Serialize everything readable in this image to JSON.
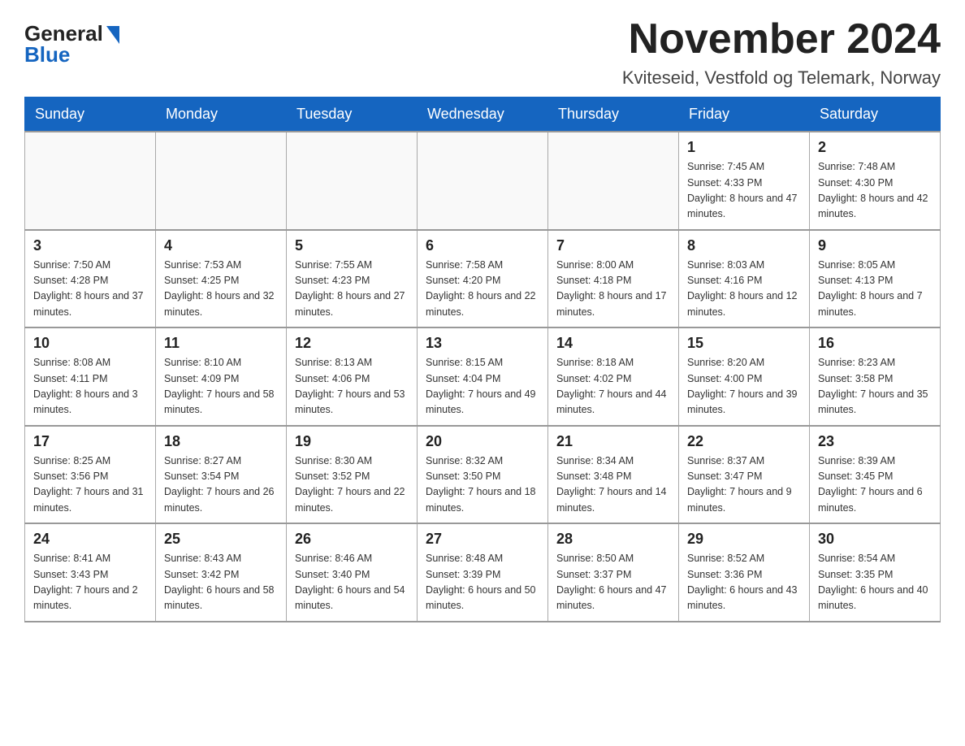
{
  "logo": {
    "general": "General",
    "blue": "Blue"
  },
  "title": "November 2024",
  "location": "Kviteseid, Vestfold og Telemark, Norway",
  "headers": [
    "Sunday",
    "Monday",
    "Tuesday",
    "Wednesday",
    "Thursday",
    "Friday",
    "Saturday"
  ],
  "weeks": [
    [
      {
        "day": "",
        "info": ""
      },
      {
        "day": "",
        "info": ""
      },
      {
        "day": "",
        "info": ""
      },
      {
        "day": "",
        "info": ""
      },
      {
        "day": "",
        "info": ""
      },
      {
        "day": "1",
        "info": "Sunrise: 7:45 AM\nSunset: 4:33 PM\nDaylight: 8 hours and 47 minutes."
      },
      {
        "day": "2",
        "info": "Sunrise: 7:48 AM\nSunset: 4:30 PM\nDaylight: 8 hours and 42 minutes."
      }
    ],
    [
      {
        "day": "3",
        "info": "Sunrise: 7:50 AM\nSunset: 4:28 PM\nDaylight: 8 hours and 37 minutes."
      },
      {
        "day": "4",
        "info": "Sunrise: 7:53 AM\nSunset: 4:25 PM\nDaylight: 8 hours and 32 minutes."
      },
      {
        "day": "5",
        "info": "Sunrise: 7:55 AM\nSunset: 4:23 PM\nDaylight: 8 hours and 27 minutes."
      },
      {
        "day": "6",
        "info": "Sunrise: 7:58 AM\nSunset: 4:20 PM\nDaylight: 8 hours and 22 minutes."
      },
      {
        "day": "7",
        "info": "Sunrise: 8:00 AM\nSunset: 4:18 PM\nDaylight: 8 hours and 17 minutes."
      },
      {
        "day": "8",
        "info": "Sunrise: 8:03 AM\nSunset: 4:16 PM\nDaylight: 8 hours and 12 minutes."
      },
      {
        "day": "9",
        "info": "Sunrise: 8:05 AM\nSunset: 4:13 PM\nDaylight: 8 hours and 7 minutes."
      }
    ],
    [
      {
        "day": "10",
        "info": "Sunrise: 8:08 AM\nSunset: 4:11 PM\nDaylight: 8 hours and 3 minutes."
      },
      {
        "day": "11",
        "info": "Sunrise: 8:10 AM\nSunset: 4:09 PM\nDaylight: 7 hours and 58 minutes."
      },
      {
        "day": "12",
        "info": "Sunrise: 8:13 AM\nSunset: 4:06 PM\nDaylight: 7 hours and 53 minutes."
      },
      {
        "day": "13",
        "info": "Sunrise: 8:15 AM\nSunset: 4:04 PM\nDaylight: 7 hours and 49 minutes."
      },
      {
        "day": "14",
        "info": "Sunrise: 8:18 AM\nSunset: 4:02 PM\nDaylight: 7 hours and 44 minutes."
      },
      {
        "day": "15",
        "info": "Sunrise: 8:20 AM\nSunset: 4:00 PM\nDaylight: 7 hours and 39 minutes."
      },
      {
        "day": "16",
        "info": "Sunrise: 8:23 AM\nSunset: 3:58 PM\nDaylight: 7 hours and 35 minutes."
      }
    ],
    [
      {
        "day": "17",
        "info": "Sunrise: 8:25 AM\nSunset: 3:56 PM\nDaylight: 7 hours and 31 minutes."
      },
      {
        "day": "18",
        "info": "Sunrise: 8:27 AM\nSunset: 3:54 PM\nDaylight: 7 hours and 26 minutes."
      },
      {
        "day": "19",
        "info": "Sunrise: 8:30 AM\nSunset: 3:52 PM\nDaylight: 7 hours and 22 minutes."
      },
      {
        "day": "20",
        "info": "Sunrise: 8:32 AM\nSunset: 3:50 PM\nDaylight: 7 hours and 18 minutes."
      },
      {
        "day": "21",
        "info": "Sunrise: 8:34 AM\nSunset: 3:48 PM\nDaylight: 7 hours and 14 minutes."
      },
      {
        "day": "22",
        "info": "Sunrise: 8:37 AM\nSunset: 3:47 PM\nDaylight: 7 hours and 9 minutes."
      },
      {
        "day": "23",
        "info": "Sunrise: 8:39 AM\nSunset: 3:45 PM\nDaylight: 7 hours and 6 minutes."
      }
    ],
    [
      {
        "day": "24",
        "info": "Sunrise: 8:41 AM\nSunset: 3:43 PM\nDaylight: 7 hours and 2 minutes."
      },
      {
        "day": "25",
        "info": "Sunrise: 8:43 AM\nSunset: 3:42 PM\nDaylight: 6 hours and 58 minutes."
      },
      {
        "day": "26",
        "info": "Sunrise: 8:46 AM\nSunset: 3:40 PM\nDaylight: 6 hours and 54 minutes."
      },
      {
        "day": "27",
        "info": "Sunrise: 8:48 AM\nSunset: 3:39 PM\nDaylight: 6 hours and 50 minutes."
      },
      {
        "day": "28",
        "info": "Sunrise: 8:50 AM\nSunset: 3:37 PM\nDaylight: 6 hours and 47 minutes."
      },
      {
        "day": "29",
        "info": "Sunrise: 8:52 AM\nSunset: 3:36 PM\nDaylight: 6 hours and 43 minutes."
      },
      {
        "day": "30",
        "info": "Sunrise: 8:54 AM\nSunset: 3:35 PM\nDaylight: 6 hours and 40 minutes."
      }
    ]
  ]
}
